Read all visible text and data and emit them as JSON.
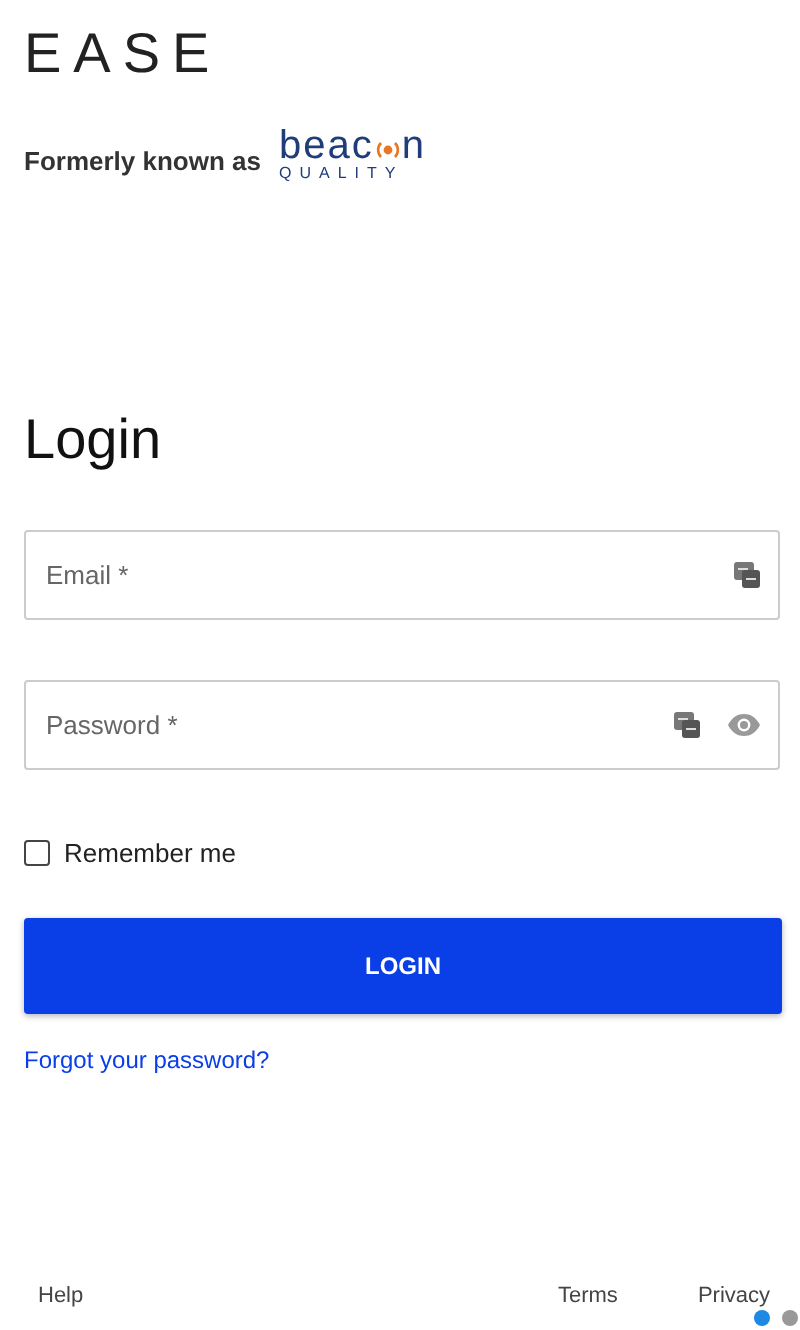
{
  "logo": {
    "text": "EASE"
  },
  "formerly": {
    "label": "Formerly known as",
    "brand_start": "beac",
    "brand_end": "n",
    "brand_sub": "QUALITY"
  },
  "heading": "Login",
  "fields": [
    {
      "placeholder": "Email *",
      "kind": "text"
    },
    {
      "placeholder": "Password *",
      "kind": "password"
    }
  ],
  "remember": {
    "label": "Remember me",
    "checked": false
  },
  "login_button": "LOGIN",
  "forgot_link": "Forgot your password?",
  "footer": {
    "links": [
      "Help",
      "Terms",
      "Privacy"
    ]
  },
  "pager": [
    {
      "selected": true
    },
    {
      "selected": false
    }
  ]
}
